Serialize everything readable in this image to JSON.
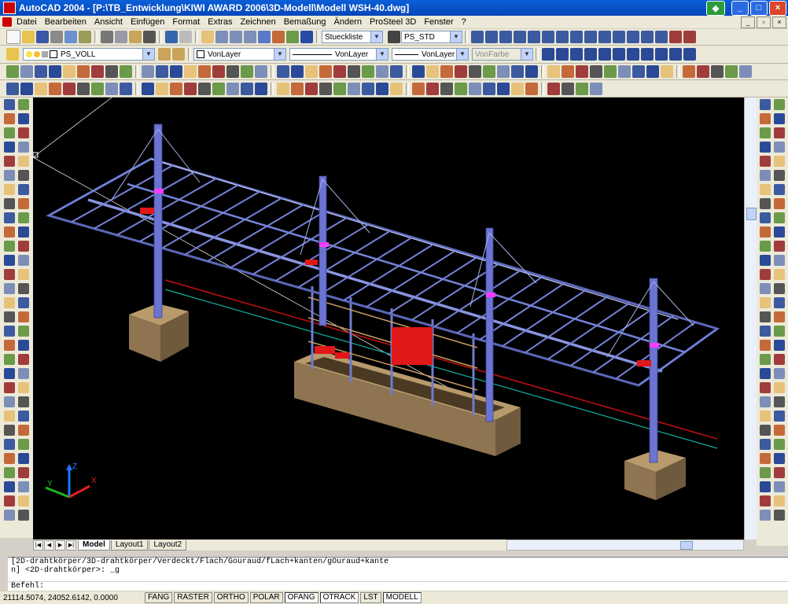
{
  "window": {
    "title": "AutoCAD 2004 - [P:\\TB_Entwicklung\\KIWI AWARD 2006\\3D-Modell\\Modell WSH-40.dwg]"
  },
  "menu": [
    "Datei",
    "Bearbeiten",
    "Ansicht",
    "Einfügen",
    "Format",
    "Extras",
    "Zeichnen",
    "Bemaßung",
    "Ändern",
    "ProSteel 3D",
    "Fenster",
    "?"
  ],
  "toolbar": {
    "stueckliste": "Stueckliste",
    "ps_std": "PS_STD",
    "layer": "PS_VOLL",
    "color": "VonLayer",
    "linetype": "VonLayer",
    "lineweight": "VonLayer",
    "plotstyle": "VonFarbe"
  },
  "tabs": [
    "Model",
    "Layout1",
    "Layout2"
  ],
  "command": {
    "line1": "[2D-drahtkörper/3D-drahtkörper/Verdeckt/Flach/Gouraud/fLach+kanten/gOuraud+kante",
    "line2": "n] <2D-drahtkörper>: _g",
    "prompt": "Befehl:"
  },
  "status": {
    "coords": "21114.5074, 24052.6142, 0.0000",
    "buttons": [
      "FANG",
      "RASTER",
      "ORTHO",
      "POLAR",
      "OFANG",
      "OTRACK",
      "LST",
      "MODELL"
    ]
  },
  "ucs": {
    "x": "X",
    "y": "Y",
    "z": "Z"
  }
}
